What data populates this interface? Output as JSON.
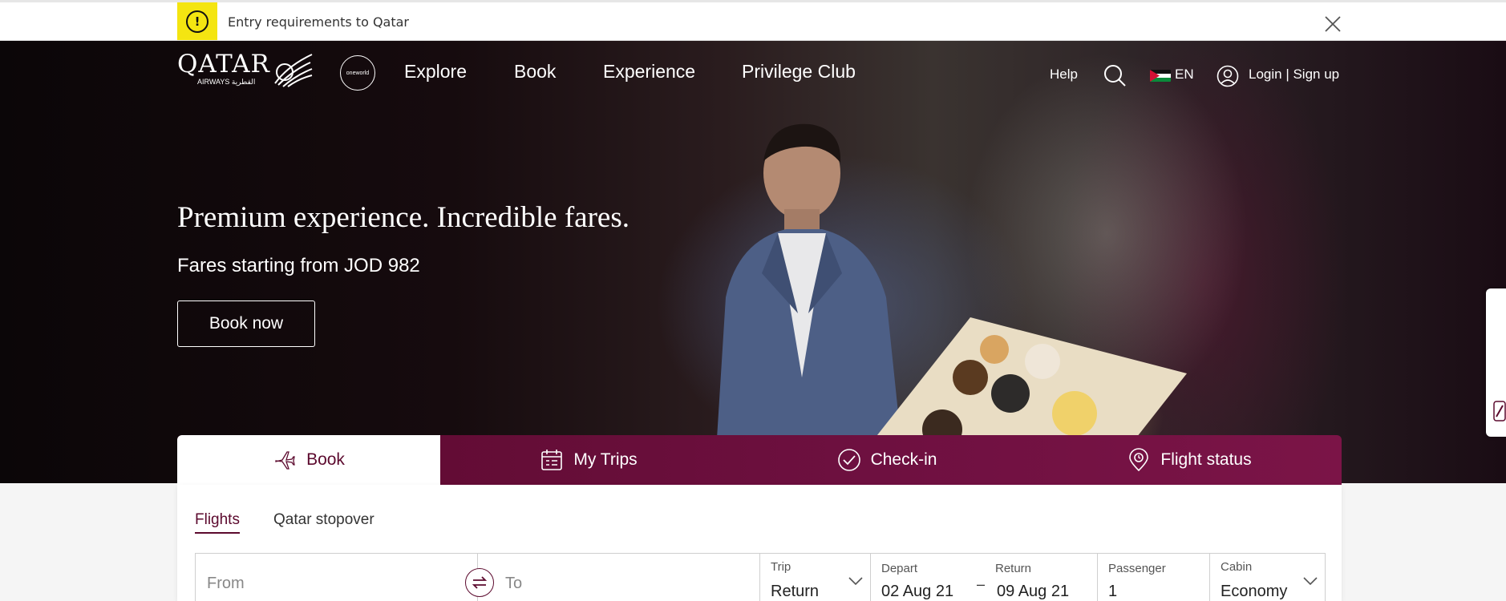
{
  "alert": {
    "icon": "alert-icon",
    "text": "Entry requirements to Qatar",
    "close_icon": "close-icon"
  },
  "header": {
    "logo_text": "QATAR",
    "logo_sub": "AIRWAYS القطرية",
    "alliance": "oneworld",
    "nav": [
      "Explore",
      "Book",
      "Experience",
      "Privilege Club"
    ],
    "help": "Help",
    "search_icon": "search-icon",
    "language": "EN",
    "login": "Login | Sign up"
  },
  "hero": {
    "title": "Premium experience. Incredible fares.",
    "subtitle": "Fares starting from JOD 982",
    "cta": "Book now"
  },
  "booking": {
    "tabs": [
      {
        "label": "Book",
        "icon": "plane-icon"
      },
      {
        "label": "My Trips",
        "icon": "calendar-icon"
      },
      {
        "label": "Check-in",
        "icon": "check-circle-icon"
      },
      {
        "label": "Flight status",
        "icon": "location-pin-icon"
      }
    ],
    "sub_tabs": [
      "Flights",
      "Qatar stopover"
    ],
    "from_placeholder": "From",
    "to_placeholder": "To",
    "trip": {
      "label": "Trip",
      "value": "Return"
    },
    "depart": {
      "label": "Depart",
      "value": "02 Aug 21"
    },
    "return": {
      "label": "Return",
      "value": "09 Aug 21"
    },
    "passenger": {
      "label": "Passenger",
      "value": "1"
    },
    "cabin": {
      "label": "Cabin",
      "value": "Economy"
    }
  },
  "colors": {
    "brand": "#5c0a2e",
    "alert": "#f4e511"
  }
}
